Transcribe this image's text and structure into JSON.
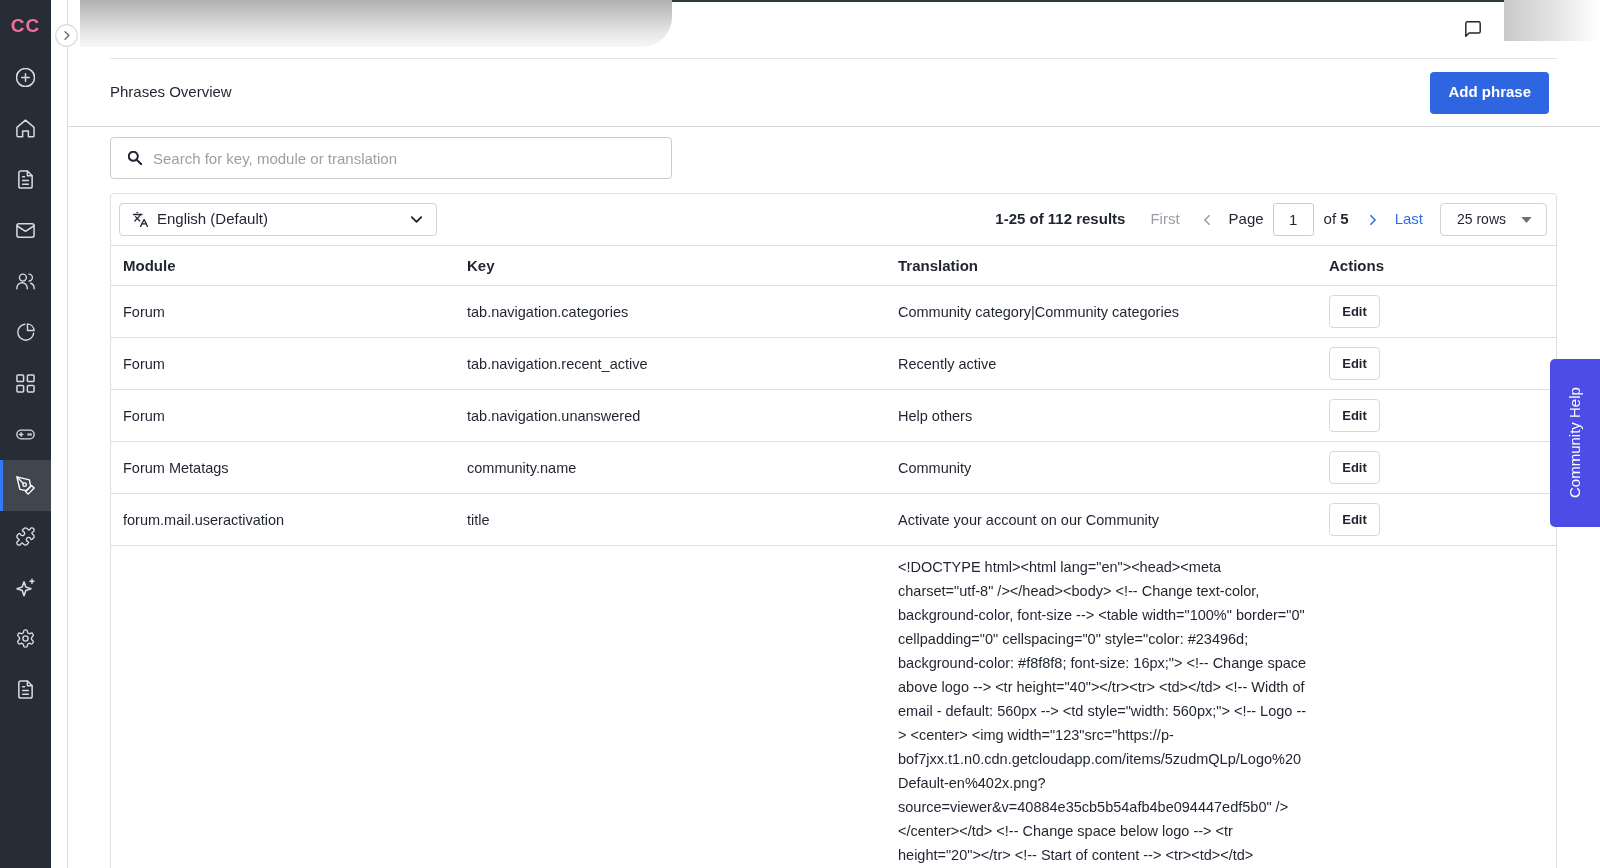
{
  "sidebar": {
    "logo": "CC",
    "items": [
      {
        "selected": false
      },
      {
        "selected": false
      },
      {
        "selected": false
      },
      {
        "selected": false
      },
      {
        "selected": false
      },
      {
        "selected": false
      },
      {
        "selected": false
      },
      {
        "selected": false
      },
      {
        "selected": true
      },
      {
        "selected": false
      },
      {
        "selected": false
      },
      {
        "selected": false
      },
      {
        "selected": false
      }
    ]
  },
  "header": {
    "title": "Phrases Overview",
    "add_button": "Add phrase"
  },
  "search": {
    "placeholder": "Search for key, module or translation"
  },
  "language_select": {
    "value": "English (Default)"
  },
  "pagination": {
    "results": "1-25 of 112 results",
    "first": {
      "label": "First",
      "disabled": true
    },
    "previous": {
      "disabled": true
    },
    "page_label": "Page",
    "page": "1",
    "of_total": "of **5**",
    "next": {
      "disabled": false
    },
    "last": {
      "label": "Last",
      "disabled": false
    }
  },
  "rows_select": {
    "value": "25 rows"
  },
  "table": {
    "columns": [
      "Module",
      "Key",
      "Translation",
      "Actions"
    ],
    "rows": [
      {
        "module": "Forum",
        "key": "tab.navigation.categories",
        "translation": "Community category|Community categories",
        "action": "Edit"
      },
      {
        "module": "Forum",
        "key": "tab.navigation.recent_active",
        "translation": "Recently active",
        "action": "Edit"
      },
      {
        "module": "Forum",
        "key": "tab.navigation.unanswered",
        "translation": "Help others",
        "action": "Edit"
      },
      {
        "module": "Forum Metatags",
        "key": "community.name",
        "translation": "Community",
        "action": "Edit"
      },
      {
        "module": "forum.mail.useractivation",
        "key": "title",
        "translation": "Activate your account on our Community",
        "action": "Edit"
      },
      {
        "translation": "<!DOCTYPE html><html lang=\"en\"><head><meta charset=\"utf-8\" /></head><body> <!-- Change text-color, background-color, font-size --> <table width=\"100%\" border=\"0\" cellpadding=\"0\" cellspacing=\"0\" style=\"color: #23496d; background-color: #f8f8f8; font-size: 16px;\"> <!-- Change space above logo --> <tr height=\"40\"></tr><tr> <td></td> <!-- Width of email - default: 560px --> <td style=\"width: 560px;\"> <!-- Logo --> <center> <img width=\"123\"src=\"https://p-bof7jxx.t1.n0.cdn.getcloudapp.com/items/5zudmQLp/Logo%20Default-en%402x.png?source=viewer&v=40884e35cb5b54afb4be094447edf5b0\" /> </center></td> <!-- Change space below logo --> <tr height=\"20\"></tr> <!-- Start of content --> <tr><td></td>"
      }
    ]
  },
  "help_tab": {
    "label": "Community Help"
  }
}
